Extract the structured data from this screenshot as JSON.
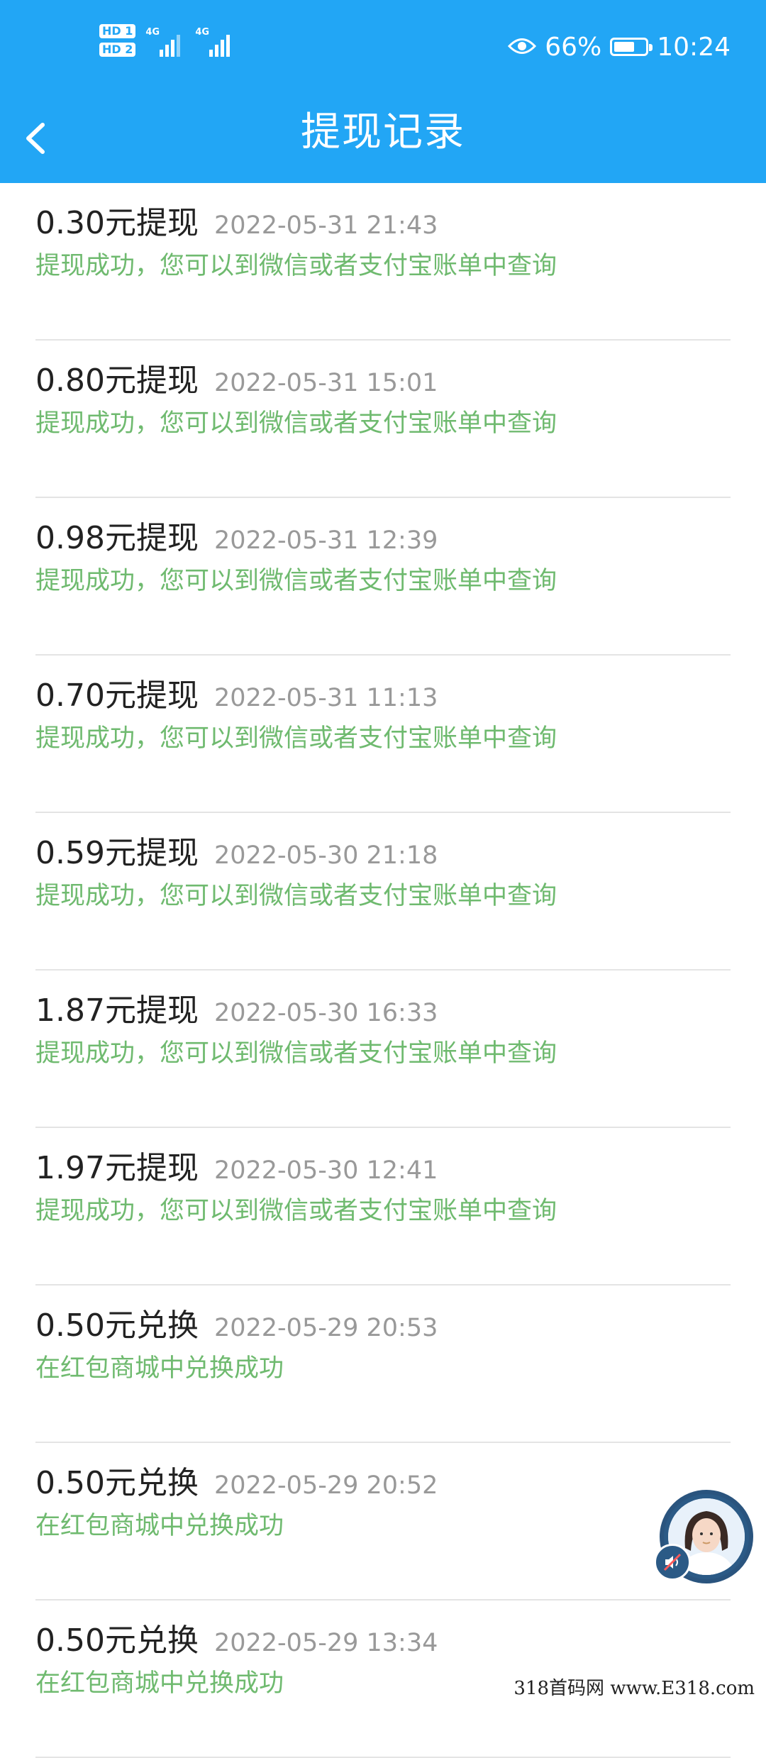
{
  "status_bar": {
    "hd1": "HD 1",
    "hd2": "HD 2",
    "net1": "4G",
    "net2": "4G",
    "battery_percent": "66%",
    "battery_level": 0.66,
    "time": "10:24",
    "eye_icon": "eye-comfort-icon"
  },
  "navbar": {
    "title": "提现记录",
    "back_icon": "chevron-left-icon",
    "color": "#22a6f5"
  },
  "records": [
    {
      "amount": "0.30元提现",
      "datetime": "2022-05-31 21:43",
      "status": "提现成功，您可以到微信或者支付宝账单中查询"
    },
    {
      "amount": "0.80元提现",
      "datetime": "2022-05-31 15:01",
      "status": "提现成功，您可以到微信或者支付宝账单中查询"
    },
    {
      "amount": "0.98元提现",
      "datetime": "2022-05-31 12:39",
      "status": "提现成功，您可以到微信或者支付宝账单中查询"
    },
    {
      "amount": "0.70元提现",
      "datetime": "2022-05-31 11:13",
      "status": "提现成功，您可以到微信或者支付宝账单中查询"
    },
    {
      "amount": "0.59元提现",
      "datetime": "2022-05-30 21:18",
      "status": "提现成功，您可以到微信或者支付宝账单中查询"
    },
    {
      "amount": "1.87元提现",
      "datetime": "2022-05-30 16:33",
      "status": "提现成功，您可以到微信或者支付宝账单中查询"
    },
    {
      "amount": "1.97元提现",
      "datetime": "2022-05-30 12:41",
      "status": "提现成功，您可以到微信或者支付宝账单中查询"
    },
    {
      "amount": "0.50元兑换",
      "datetime": "2022-05-29 20:53",
      "status": "在红包商城中兑换成功"
    },
    {
      "amount": "0.50元兑换",
      "datetime": "2022-05-29 20:52",
      "status": "在红包商城中兑换成功"
    },
    {
      "amount": "0.50元兑换",
      "datetime": "2022-05-29 13:34",
      "status": "在红包商城中兑换成功"
    }
  ],
  "colors": {
    "status_green": "#6fba6f",
    "date_gray": "#999999"
  },
  "floating_widget": {
    "avatar_icon": "avatar-girl-icon",
    "badge_icon": "mute-speaker-icon"
  },
  "watermark": "318首码网 www.E318.com"
}
